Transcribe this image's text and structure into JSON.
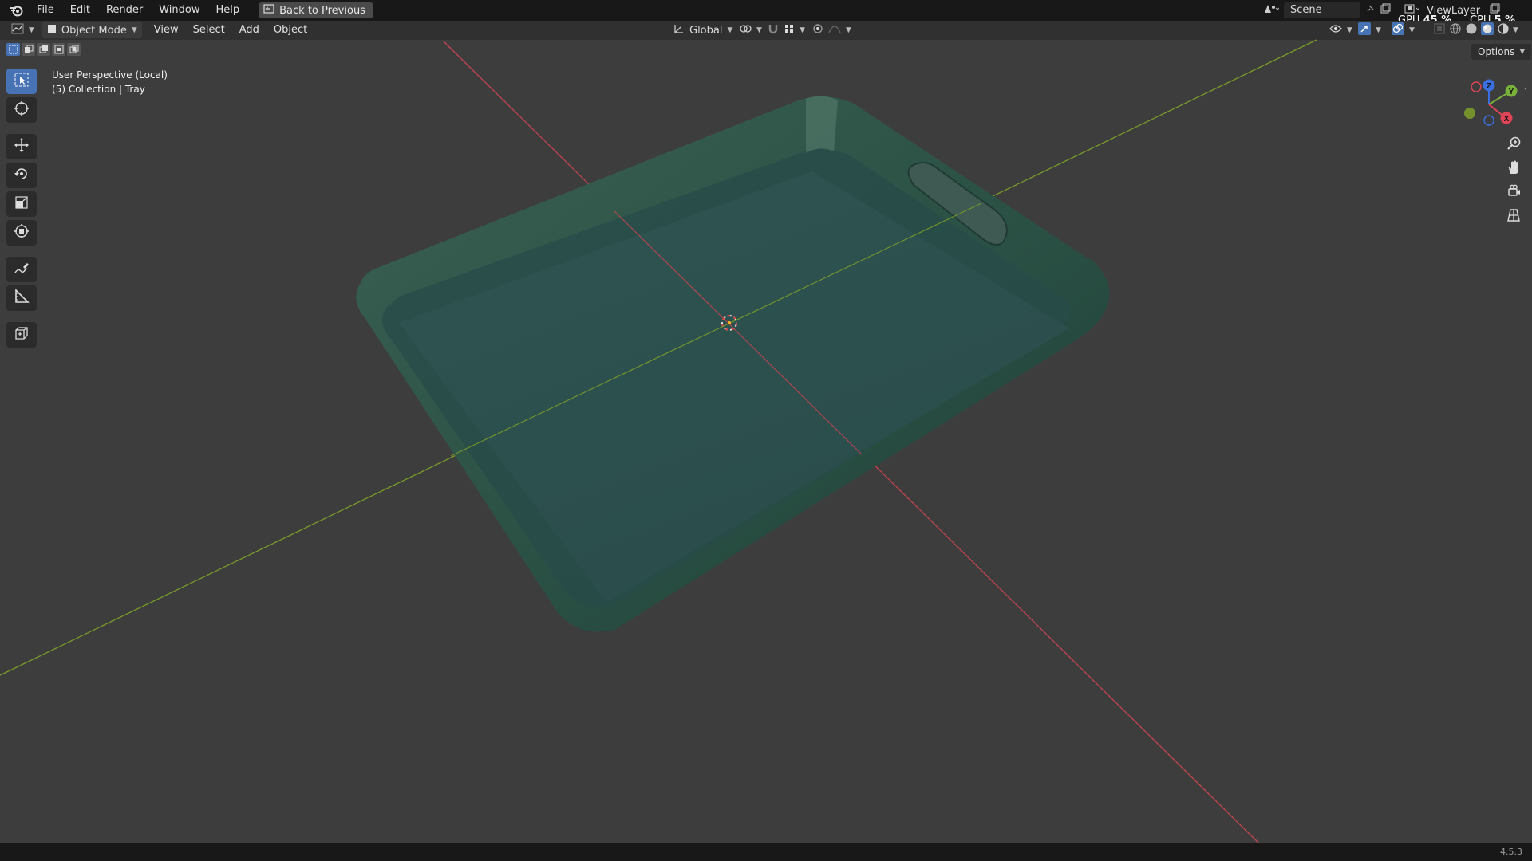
{
  "topbar": {
    "menus": [
      "File",
      "Edit",
      "Render",
      "Window",
      "Help"
    ],
    "back_button": "Back to Previous",
    "scene_label": "Scene",
    "viewlayer_label": "ViewLayer",
    "gpu_label": "GPU",
    "gpu_value": "45 %",
    "cpu_label": "CPU",
    "cpu_value": "5 %"
  },
  "header": {
    "mode": "Object Mode",
    "menus": [
      "View",
      "Select",
      "Add",
      "Object"
    ],
    "transform_orientation": "Global",
    "options": "Options"
  },
  "viewport": {
    "perspective_label": "User Perspective (Local)",
    "collection_label": "(5) Collection | Tray",
    "object_color": "#2f5a4e",
    "grid_x_color": "#c0454f",
    "grid_y_color": "#7a9a2a"
  },
  "gizmo": {
    "z": "Z",
    "y": "Y",
    "x": "X"
  },
  "statusbar": {
    "version": "4.5.3"
  }
}
